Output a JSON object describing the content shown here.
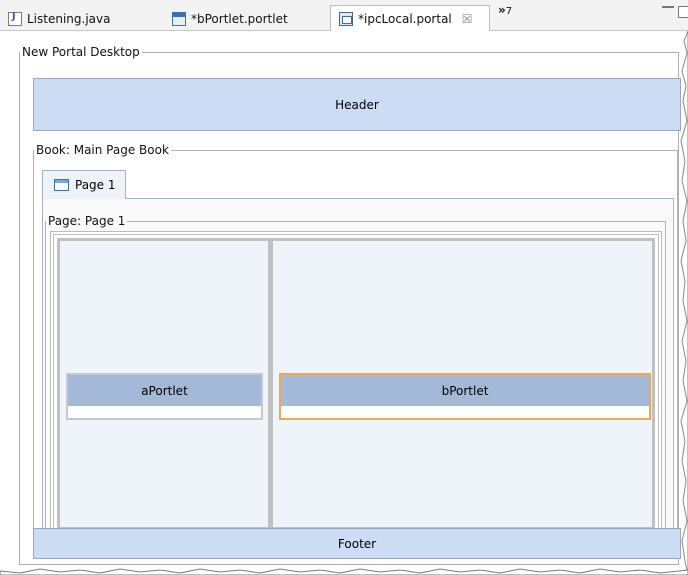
{
  "tabs": [
    {
      "label": "Listening.java",
      "icon": "java-file-icon",
      "active": false
    },
    {
      "label": "*bPortlet.portlet",
      "icon": "portlet-file-icon",
      "active": false
    },
    {
      "label": "*ipcLocal.portal",
      "icon": "portal-file-icon",
      "active": true
    }
  ],
  "tab_overflow": {
    "chevron": "»",
    "count": "7"
  },
  "close_glyph": "☒",
  "desktop": {
    "legend": "New Portal Desktop",
    "header_label": "Header",
    "footer_label": "Footer",
    "book": {
      "legend": "Book: Main Page Book",
      "page_tab_label": "Page 1",
      "page": {
        "legend": "Page: Page 1",
        "portlets": [
          {
            "label": "aPortlet"
          },
          {
            "label": "bPortlet",
            "selected": true
          }
        ]
      }
    }
  },
  "colors": {
    "header_footer_bg": "#ccdcf4",
    "portlet_title_bg": "#a4b8d8",
    "selection_border": "#f0a850",
    "column_bg": "#eef4fa"
  }
}
